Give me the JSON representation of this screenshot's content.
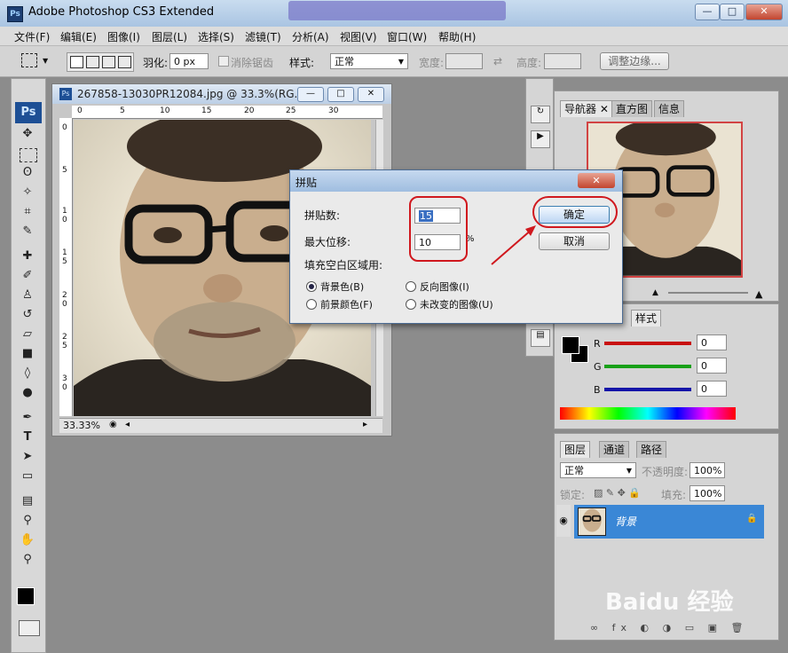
{
  "app": {
    "title": "Adobe Photoshop CS3 Extended",
    "logo": "Ps"
  },
  "window_buttons": {
    "minimize": "—",
    "maximize": "□",
    "close": "✕"
  },
  "menu": [
    "文件(F)",
    "编辑(E)",
    "图像(I)",
    "图层(L)",
    "选择(S)",
    "滤镜(T)",
    "分析(A)",
    "视图(V)",
    "窗口(W)",
    "帮助(H)"
  ],
  "options": {
    "feather_label": "羽化:",
    "feather_value": "0 px",
    "antialias_label": "消除锯齿",
    "style_label": "样式:",
    "style_value": "正常",
    "width_label": "宽度:",
    "height_label": "高度:",
    "refine_button": "调整边缘..."
  },
  "document": {
    "title": "267858-13030PR12084.jpg @ 33.3%(RG...",
    "zoom": "33.33%",
    "ruler_h": [
      "0",
      "5",
      "10",
      "15",
      "20",
      "25",
      "30"
    ],
    "ruler_v": [
      "0",
      "5",
      "1\n0",
      "1\n5",
      "2\n0",
      "2\n5",
      "3\n0"
    ]
  },
  "dialog": {
    "title": "拼贴",
    "close": "✕",
    "tiles_label": "拼贴数:",
    "tiles_value": "15",
    "offset_label": "最大位移:",
    "offset_value": "10",
    "percent": "%",
    "fill_label": "填充空白区域用:",
    "options": [
      "背景色(B)",
      "反向图像(I)",
      "前景颜色(F)",
      "未改变的图像(U)"
    ],
    "selected": 0,
    "ok": "确定",
    "cancel": "取消"
  },
  "navigator": {
    "tabs": [
      "导航器",
      "直方图",
      "信息"
    ]
  },
  "color_panel": {
    "tab": "样式",
    "channels": [
      {
        "name": "R",
        "value": "0",
        "color": "#d01010"
      },
      {
        "name": "G",
        "value": "0",
        "color": "#10a010"
      },
      {
        "name": "B",
        "value": "0",
        "color": "#1010b0"
      }
    ]
  },
  "layers": {
    "tabs": [
      "图层",
      "通道",
      "路径"
    ],
    "blend_mode": "正常",
    "opacity_label": "不透明度:",
    "opacity_value": "100%",
    "lock_label": "锁定:",
    "fill_label": "填充:",
    "fill_value": "100%",
    "layer_name": "背景"
  },
  "watermark": "Baidu 经验",
  "colors": {
    "accent": "#3a87d6",
    "annotation": "#d0181e"
  }
}
